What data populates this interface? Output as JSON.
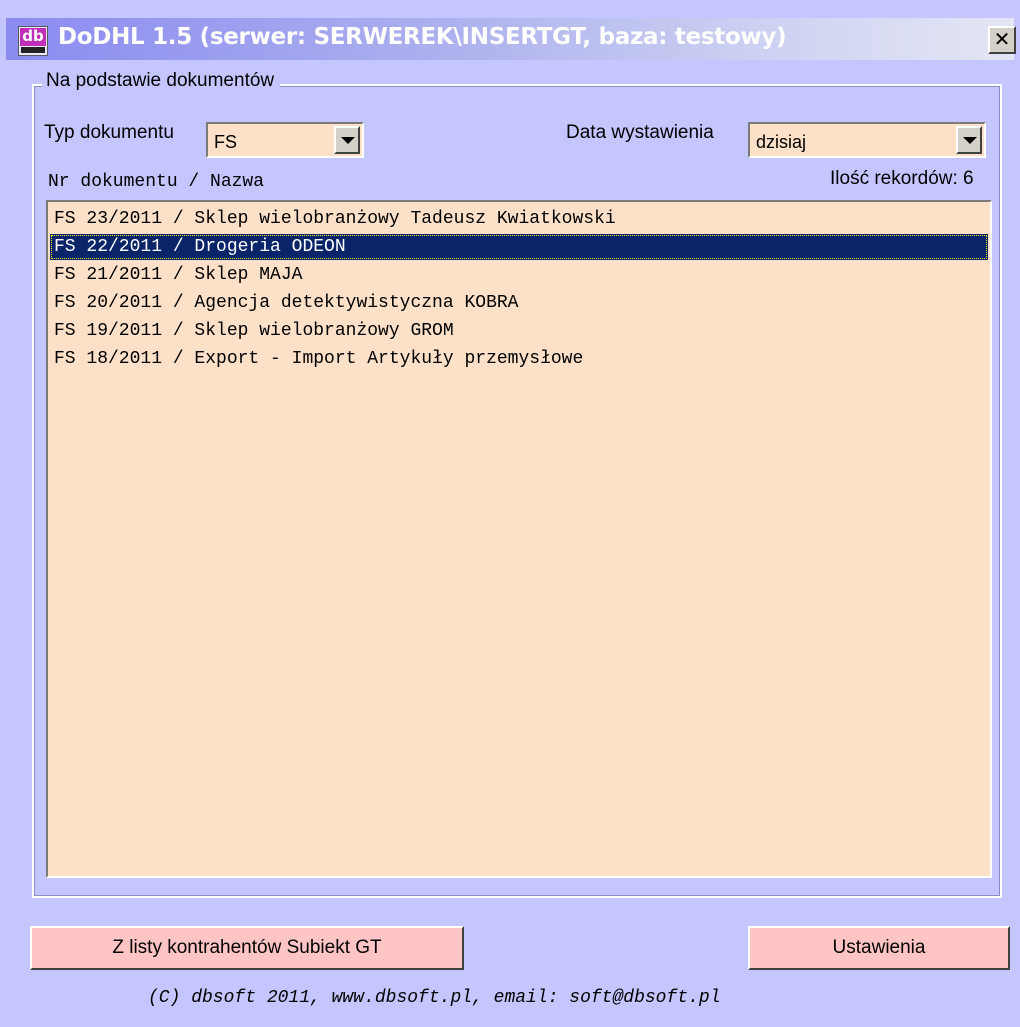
{
  "window": {
    "title": "DoDHL 1.5 (serwer: SERWEREK\\INSERTGT, baza: testowy)",
    "icon_text": "db",
    "close_label": "✕"
  },
  "group": {
    "legend": "Na podstawie dokumentów"
  },
  "filters": {
    "typ_label": "Typ dokumentu",
    "typ_value": "FS",
    "data_label": "Data wystawienia",
    "data_value": "dzisiaj"
  },
  "list": {
    "header": "Nr dokumentu / Nazwa",
    "count_label": "Ilość rekordów: 6",
    "items": [
      "FS 23/2011 / Sklep wielobranżowy Tadeusz Kwiatkowski",
      "FS 22/2011 / Drogeria ODEON",
      "FS 21/2011 / Sklep MAJA",
      "FS 20/2011 / Agencja detektywistyczna KOBRA",
      "FS 19/2011 / Sklep wielobranżowy GROM",
      "FS 18/2011 / Export - Import Artykuły przemysłowe"
    ],
    "selected_index": 1
  },
  "buttons": {
    "contractors": "Z listy kontrahentów Subiekt GT",
    "settings": "Ustawienia"
  },
  "footer": {
    "text": "(C) dbsoft 2011, www.dbsoft.pl, email: soft@dbsoft.pl"
  },
  "colors": {
    "window_bg": "#c5c5ff",
    "field_bg": "#fce0c8",
    "button_bg": "#ffc4c4",
    "selection_bg": "#0a246a"
  }
}
